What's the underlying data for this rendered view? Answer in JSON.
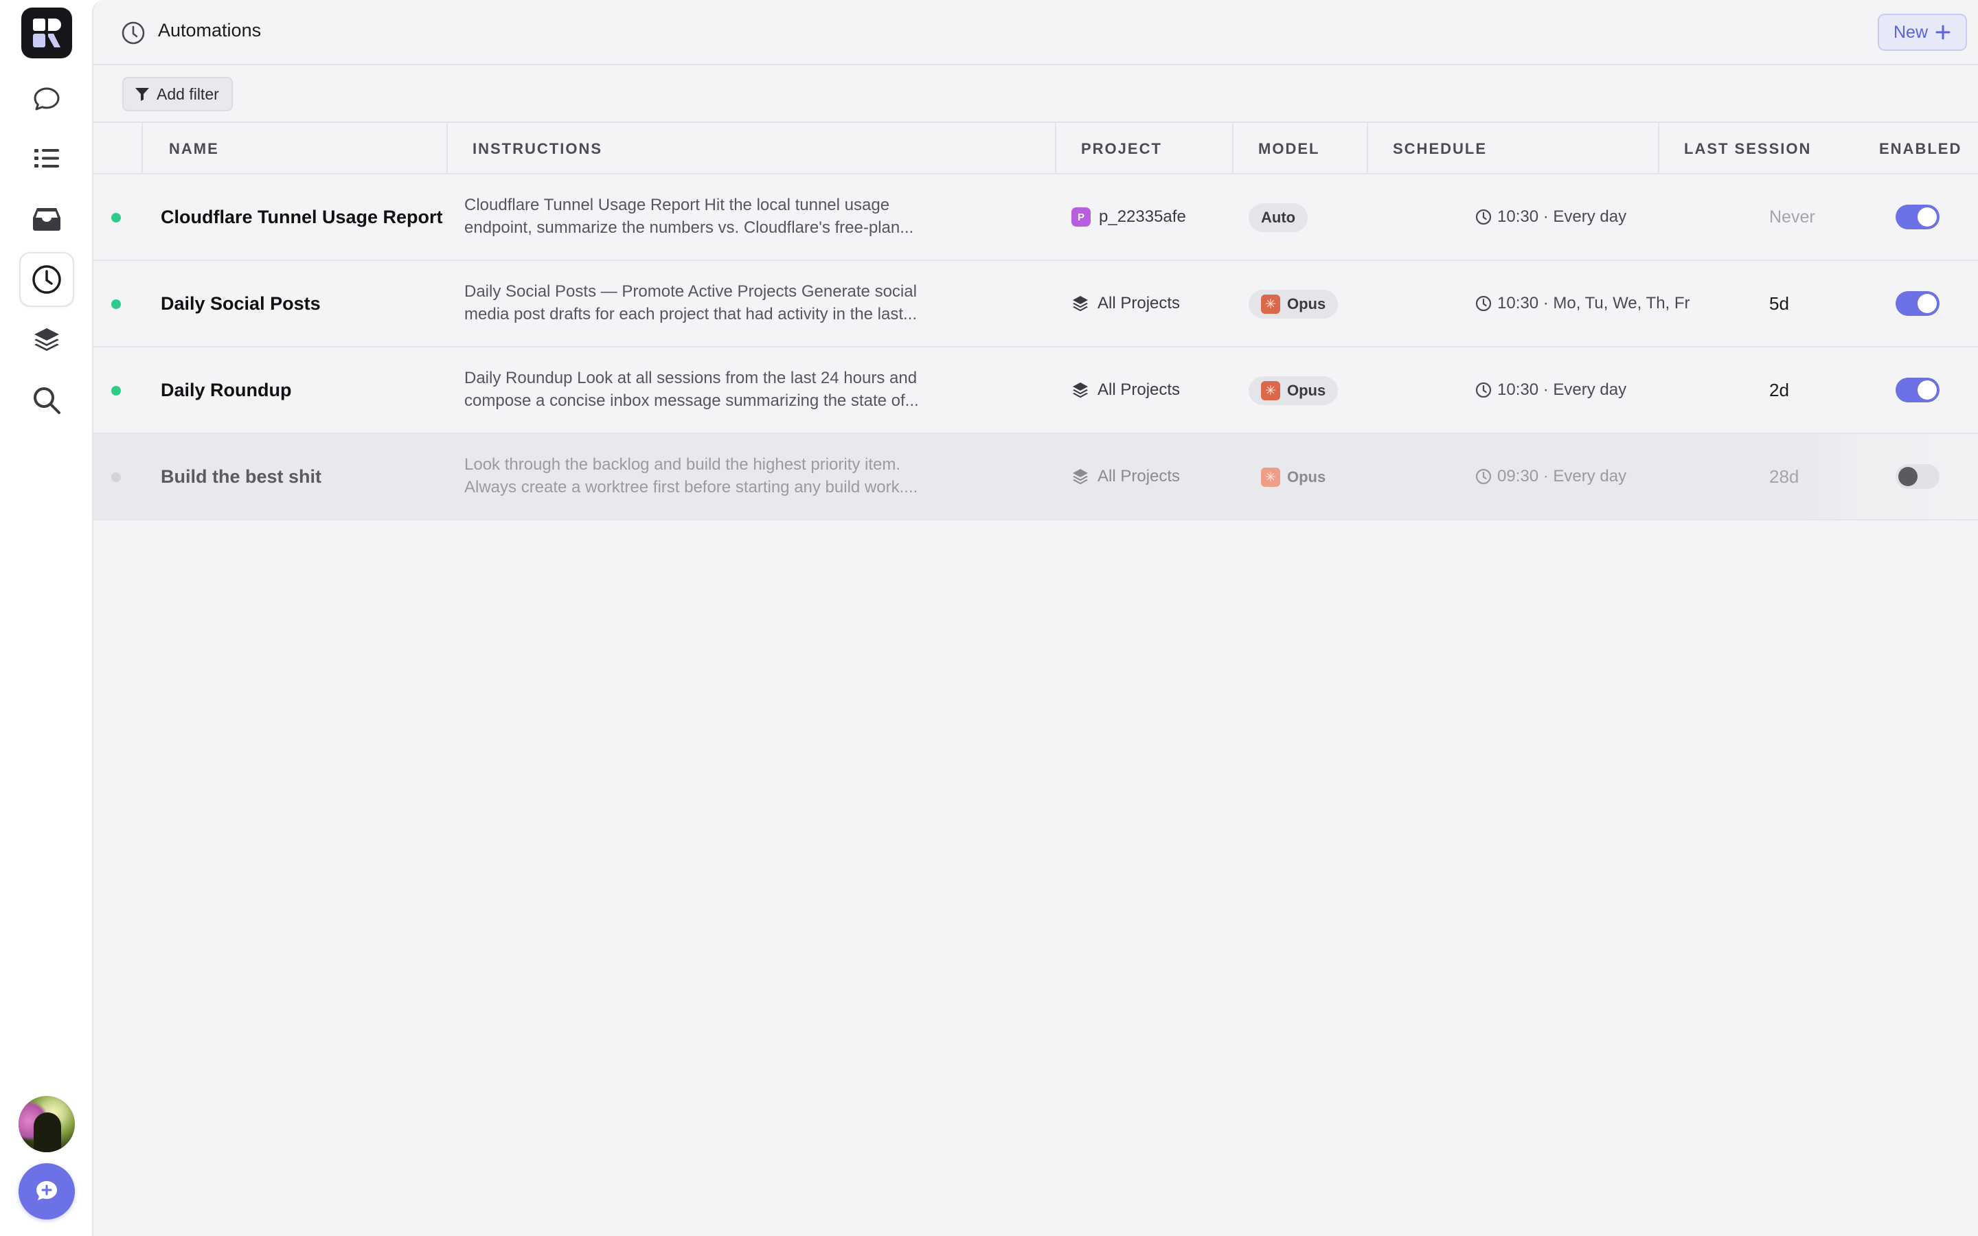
{
  "header": {
    "title": "Automations",
    "new_label": "New"
  },
  "toolbar": {
    "filter_label": "Add filter"
  },
  "table": {
    "columns": [
      "NAME",
      "INSTRUCTIONS",
      "PROJECT",
      "MODEL",
      "SCHEDULE",
      "LAST SESSION",
      "ENABLED"
    ],
    "rows": [
      {
        "name": "Cloudflare Tunnel Usage Report",
        "instructions_line1": "Cloudflare Tunnel Usage Report Hit the local tunnel usage",
        "instructions_line2": "endpoint, summarize the numbers vs. Cloudflare's free-plan...",
        "project": "p_22335afe",
        "project_tag": "P",
        "model": "Auto",
        "schedule": "10:30 · Every day",
        "last_session": "Never",
        "enabled": true
      },
      {
        "name": "Daily Social Posts",
        "instructions_line1": "Daily Social Posts — Promote Active Projects Generate social",
        "instructions_line2": "media post drafts for each project that had activity in the last...",
        "project": "All Projects",
        "model": "Opus",
        "schedule": "10:30 · Mo, Tu, We, Th, Fr",
        "last_session": "5d",
        "enabled": true
      },
      {
        "name": "Daily Roundup",
        "instructions_line1": "Daily Roundup Look at all sessions from the last 24 hours and",
        "instructions_line2": "compose a concise inbox message summarizing the state of...",
        "project": "All Projects",
        "model": "Opus",
        "schedule": "10:30 · Every day",
        "last_session": "2d",
        "enabled": true
      },
      {
        "name": "Build the best shit",
        "instructions_line1": "Look through the backlog and build the highest priority item.",
        "instructions_line2": "Always create a worktree first before starting any build work....",
        "project": "All Projects",
        "model": "Opus",
        "schedule": "09:30 · Every day",
        "last_session": "28d",
        "enabled": false
      }
    ]
  },
  "rail": {
    "items": [
      "logo-icon",
      "chat-bubble-icon",
      "list-icon",
      "inbox-icon",
      "clock-icon",
      "layers-icon",
      "search-icon"
    ],
    "active": "clock-icon"
  },
  "colors": {
    "accent": "#6c72e6",
    "status_active": "#2ecc8a",
    "status_inactive": "#d4d4d8",
    "claude_brand": "#d9694a",
    "project_tag": "#b65de0"
  }
}
